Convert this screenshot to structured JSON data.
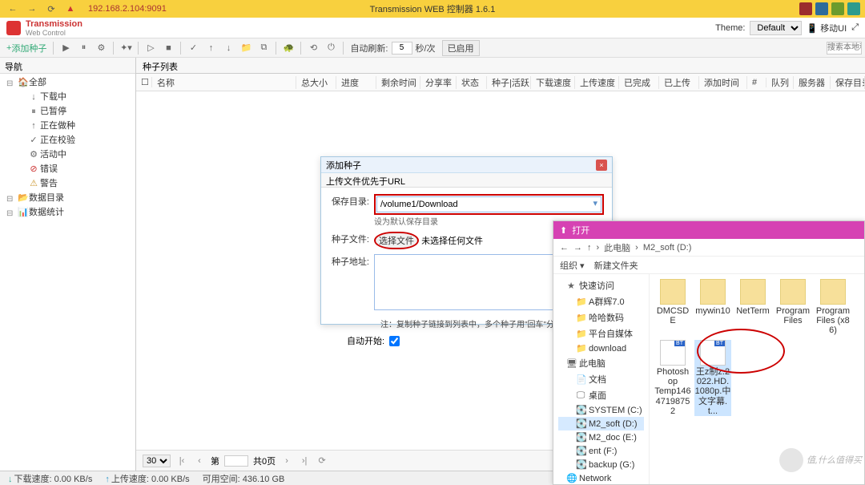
{
  "browser": {
    "url": "192.168.2.104:9091",
    "title": "Transmission WEB 控制器 1.6.1"
  },
  "brand": {
    "name": "Transmission",
    "sub": "Web Control"
  },
  "theme": {
    "label": "Theme:",
    "value": "Default",
    "mobile": "移动UI"
  },
  "toolbar": {
    "add": "添加种子",
    "auto_refresh_label": "自动刷新:",
    "auto_refresh_value": "5",
    "auto_refresh_unit": "秒/次",
    "enabled": "已启用",
    "search_placeholder": "搜索本地种"
  },
  "tree": {
    "nav": "导航",
    "all": "全部",
    "downloading": "下载中",
    "paused": "已暂停",
    "seeding": "正在做种",
    "checking": "正在校验",
    "active": "活动中",
    "error": "错误",
    "warn": "警告",
    "data_dir": "数据目录",
    "stats": "数据统计"
  },
  "grid": {
    "tab": "种子列表",
    "cols": {
      "name": "名称",
      "total_size": "总大小",
      "progress": "进度",
      "remain": "剩余时间",
      "share": "分享率",
      "status": "状态",
      "seed_act": "种子|活跃",
      "dl_speed": "下载速度",
      "ul_speed": "上传速度",
      "completed": "已完成",
      "uploaded": "已上传",
      "added": "添加时间",
      "num": "#",
      "queue": "队列",
      "tracker": "服务器",
      "save_dir": "保存目录"
    },
    "pager": {
      "size": "30",
      "page_label": "第",
      "page_val": "",
      "total": "共0页"
    }
  },
  "status": {
    "dl": "下载速度:",
    "dl_val": "0.00 KB/s",
    "ul": "上传速度:",
    "ul_val": "0.00 KB/s",
    "free": "可用空间:",
    "free_val": "436.10 GB"
  },
  "dialog": {
    "title": "添加种子",
    "subtitle": "上传文件优先于URL",
    "save_dir_label": "保存目录:",
    "save_dir_value": "/volume1/Download",
    "save_dir_note": "设为默认保存目录",
    "seed_file_label": "种子文件:",
    "choose_file_btn": "选择文件",
    "no_file": "未选择任何文件",
    "seed_url_label": "种子地址:",
    "note": "注：复制种子链接到列表中，多个种子用\"回车\"分隔。",
    "auto_start": "自动开始:"
  },
  "file_dialog": {
    "title": "打开",
    "crumb": "此电脑",
    "crumb2": "M2_soft (D:)",
    "organize": "组织 ▾",
    "new_folder": "新建文件夹",
    "tree": {
      "quick": "快速访问",
      "a": "A群辉7.0",
      "hh": "哈哈数码",
      "pt": "平台自媒体",
      "dl": "download",
      "pc": "此电脑",
      "docs": "文档",
      "desktop": "桌面",
      "sysc": "SYSTEM (C:)",
      "m2d": "M2_soft (D:)",
      "m2e": "M2_doc (E:)",
      "entf": "ent (F:)",
      "bkg": "backup (G:)",
      "net": "Network"
    },
    "items": [
      {
        "label": "DMCSDE",
        "type": "folder"
      },
      {
        "label": "mywin10",
        "type": "folder"
      },
      {
        "label": "NetTerm",
        "type": "folder"
      },
      {
        "label": "Program Files",
        "type": "folder"
      },
      {
        "label": "Program Files (x86)",
        "type": "folder"
      },
      {
        "label": "Photoshop\nTemp14647198752",
        "type": "file"
      },
      {
        "label": "王z制z.2022.HD.1080p.中文字幕.t...",
        "type": "file",
        "selected": true
      }
    ]
  },
  "watermark": "值,什么值得买"
}
